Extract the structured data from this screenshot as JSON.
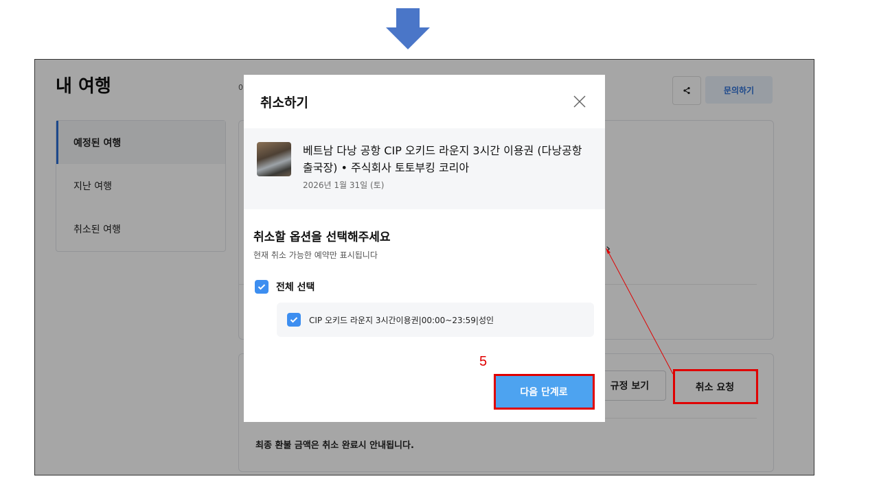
{
  "page": {
    "title": "내 여행",
    "breadcrumb": "0"
  },
  "header": {
    "share_icon": "share-icon",
    "inquiry_label": "문의하기"
  },
  "sidebar": {
    "items": [
      {
        "label": "예정된 여행",
        "active": true
      },
      {
        "label": "지난 여행",
        "active": false
      },
      {
        "label": "취소된 여행",
        "active": false
      }
    ]
  },
  "background_card": {
    "policy_label": "규정 보기",
    "cancel_request_label": "취소 요청",
    "refund_note": "최종 환불 금액은 취소 완료시 안내됩니다."
  },
  "modal": {
    "title": "취소하기",
    "close_icon": "close-icon",
    "product": {
      "name": "베트남 다낭 공항 CIP 오키드 라운지 3시간 이용권 (다낭공항 출국장) • 주식회사 토토부킹 코리아",
      "date": "2026년 1월 31일 (토)"
    },
    "options_title": "취소할 옵션을 선택해주세요",
    "options_subtitle": "현재 취소 가능한 예약만 표시됩니다",
    "select_all_label": "전체 선택",
    "select_all_checked": true,
    "options": [
      {
        "label": "CIP 오키드 라운지 3시간이용권|00:00~23:59|성인",
        "checked": true
      }
    ],
    "next_label": "다음 단계로"
  },
  "annotation": {
    "step_number": "5",
    "highlight_color": "#e00000",
    "arrow_color": "#4a76c8"
  },
  "colors": {
    "accent": "#2b6fd6",
    "primary_button": "#4da3f0",
    "checkbox": "#3d8ef0"
  }
}
